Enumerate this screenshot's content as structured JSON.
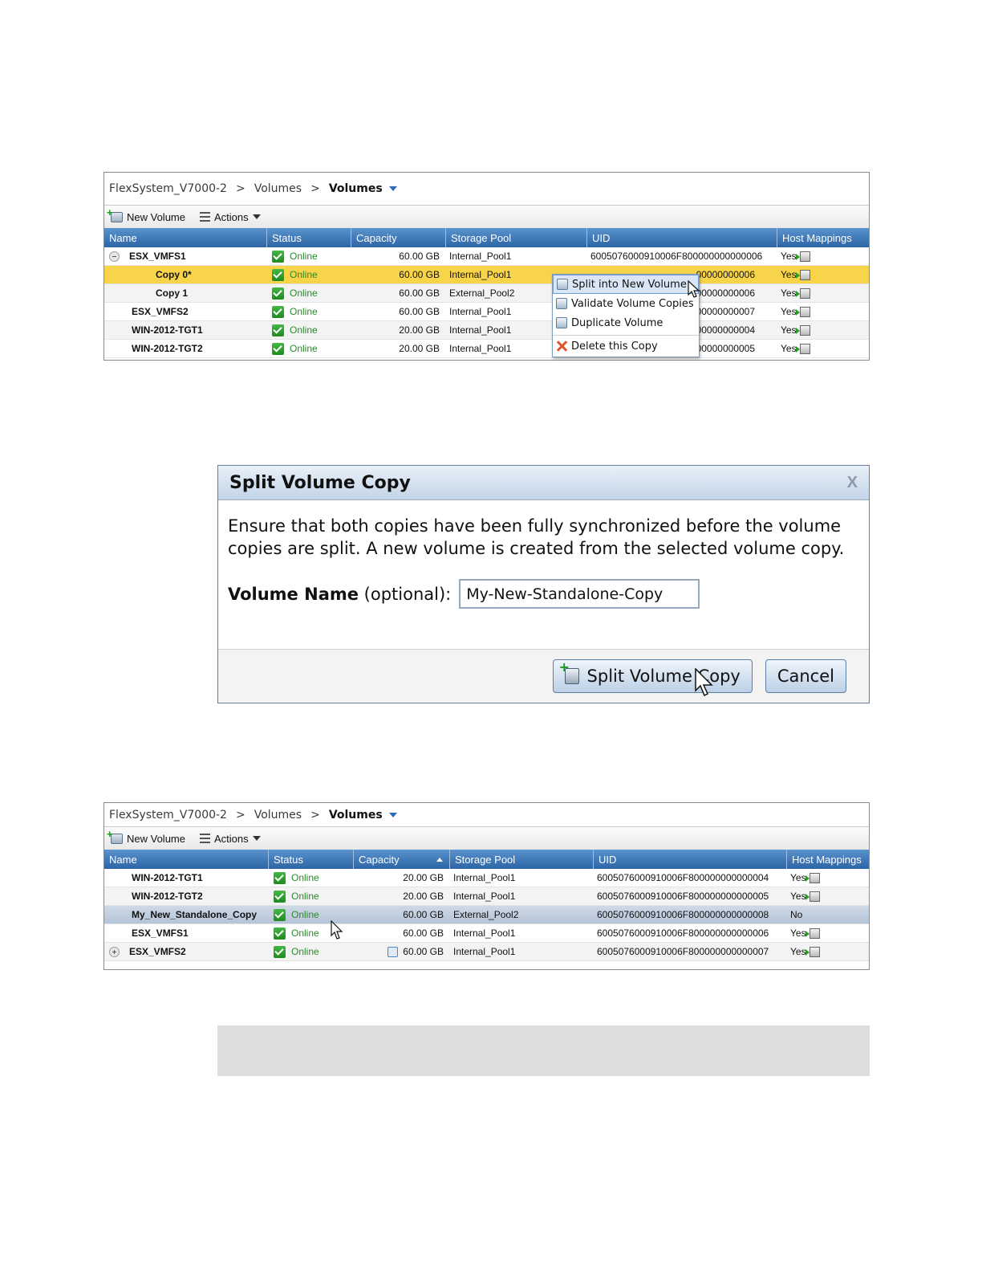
{
  "panel1": {
    "breadcrumb": {
      "root": "FlexSystem_V7000-2",
      "sep1": ">",
      "mid": "Volumes",
      "sep2": ">",
      "current": "Volumes"
    },
    "toolbar": {
      "new_volume": "New Volume",
      "actions": "Actions"
    },
    "columns": [
      "Name",
      "Status",
      "Capacity",
      "Storage Pool",
      "UID",
      "Host Mappings"
    ],
    "rows": [
      {
        "name": "ESX_VMFS1",
        "status": "Online",
        "capacity": "60.00 GB",
        "pool": "Internal_Pool1",
        "uid": "6005076000910006F800000000000006",
        "host": "Yes"
      },
      {
        "name": "Copy 0*",
        "status": "Online",
        "capacity": "60.00 GB",
        "pool": "Internal_Pool1",
        "uid": "00000000006",
        "host": "Yes"
      },
      {
        "name": "Copy 1",
        "status": "Online",
        "capacity": "60.00 GB",
        "pool": "External_Pool2",
        "uid": "00000000006",
        "host": "Yes"
      },
      {
        "name": "ESX_VMFS2",
        "status": "Online",
        "capacity": "60.00 GB",
        "pool": "Internal_Pool1",
        "uid": "00000000007",
        "host": "Yes"
      },
      {
        "name": "WIN-2012-TGT1",
        "status": "Online",
        "capacity": "20.00 GB",
        "pool": "Internal_Pool1",
        "uid": "00000000004",
        "host": "Yes"
      },
      {
        "name": "WIN-2012-TGT2",
        "status": "Online",
        "capacity": "20.00 GB",
        "pool": "Internal_Pool1",
        "uid": "00000000005",
        "host": "Yes"
      }
    ],
    "context_menu": [
      "Split into New Volume",
      "Validate Volume Copies",
      "Duplicate Volume",
      "Delete this Copy"
    ]
  },
  "dialog": {
    "title": "Split Volume Copy",
    "close": "X",
    "message": "Ensure that both copies have been fully synchronized before the volume copies are split. A new volume is created from the selected volume copy.",
    "field_label_bold": "Volume Name",
    "field_label_rest": " (optional):",
    "field_value": "My-New-Standalone-Copy",
    "primary_button": "Split Volume Copy",
    "cancel_button": "Cancel"
  },
  "panel3": {
    "breadcrumb": {
      "root": "FlexSystem_V7000-2",
      "sep1": ">",
      "mid": "Volumes",
      "sep2": ">",
      "current": "Volumes"
    },
    "toolbar": {
      "new_volume": "New Volume",
      "actions": "Actions"
    },
    "columns": [
      "Name",
      "Status",
      "Capacity",
      "Storage Pool",
      "UID",
      "Host Mappings"
    ],
    "sorted_column": "Capacity",
    "rows": [
      {
        "name": "WIN-2012-TGT1",
        "status": "Online",
        "capacity": "20.00 GB",
        "pool": "Internal_Pool1",
        "uid": "6005076000910006F800000000000004",
        "host": "Yes"
      },
      {
        "name": "WIN-2012-TGT2",
        "status": "Online",
        "capacity": "20.00 GB",
        "pool": "Internal_Pool1",
        "uid": "6005076000910006F800000000000005",
        "host": "Yes"
      },
      {
        "name": "My_New_Standalone_Copy",
        "status": "Online",
        "capacity": "60.00 GB",
        "pool": "External_Pool2",
        "uid": "6005076000910006F800000000000008",
        "host": "No"
      },
      {
        "name": "ESX_VMFS1",
        "status": "Online",
        "capacity": "60.00 GB",
        "pool": "Internal_Pool1",
        "uid": "6005076000910006F800000000000006",
        "host": "Yes"
      },
      {
        "name": "ESX_VMFS2",
        "status": "Online",
        "capacity": "60.00 GB",
        "pool": "Internal_Pool1",
        "uid": "6005076000910006F800000000000007",
        "host": "Yes"
      }
    ]
  },
  "colors": {
    "header_blue": "#2c64a6",
    "highlight_yellow": "#f8d44a",
    "online_green": "#2a8a2a",
    "selected_blue": "#b4c4d8"
  }
}
